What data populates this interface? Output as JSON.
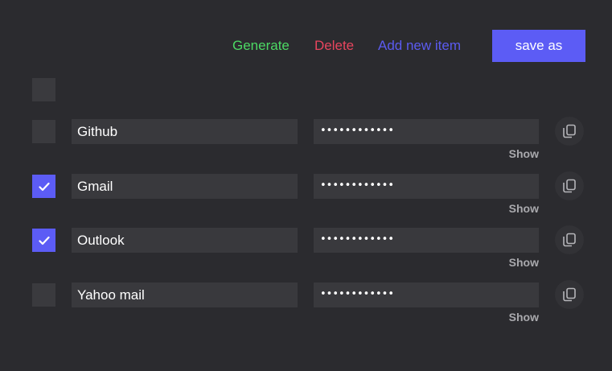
{
  "toolbar": {
    "generate_label": "Generate",
    "delete_label": "Delete",
    "add_label": "Add new item",
    "save_label": "save as"
  },
  "colors": {
    "generate": "#4cd964",
    "delete": "#e8455e",
    "add": "#5b5bf0",
    "accent": "#5c5cf5",
    "text_muted": "#a9a9ad"
  },
  "items": [
    {
      "name": "Github",
      "password": "••••••••••••",
      "show_label": "Show",
      "checked": false
    },
    {
      "name": "Gmail",
      "password": "••••••••••••",
      "show_label": "Show",
      "checked": true
    },
    {
      "name": "Outlook",
      "password": "••••••••••••",
      "show_label": "Show",
      "checked": true
    },
    {
      "name": "Yahoo mail",
      "password": "••••••••••••",
      "show_label": "Show",
      "checked": false
    }
  ]
}
